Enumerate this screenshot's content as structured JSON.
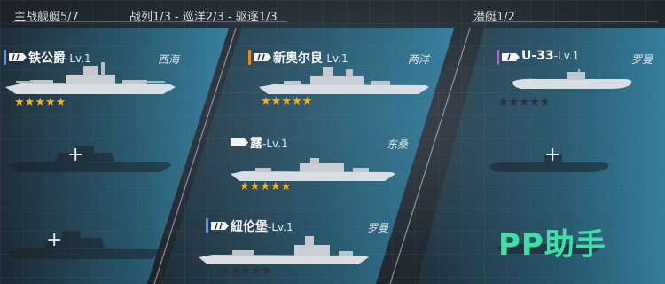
{
  "header": {
    "main_fleet": "主战舰艇5/7",
    "composition": "战列1/3 - 巡洋2/3 - 驱逐1/3",
    "submarine": "潜艇1/2"
  },
  "colors": {
    "panel": "#3a7a96",
    "star_on": "#f2b01e",
    "star_off": "#2b3339",
    "flag_battleship": "#6f94c8",
    "flag_cruiser": "#e08a2a",
    "flag_destroyer": "#6f94c8",
    "flag_submarine": "#9a72c8",
    "watermark": "#3ee0a8"
  },
  "battleships": {
    "slots": [
      {
        "name": "铁公爵",
        "level": "-Lv.1",
        "nation": "西海",
        "stars": 5,
        "max_stars": 5,
        "icon": "battleship-class-icon"
      },
      {
        "empty": true,
        "icon": "plus-icon"
      },
      {
        "empty": true,
        "icon": "plus-icon"
      }
    ]
  },
  "cruisers_destroyers": {
    "slots": [
      {
        "name": "新奥尔良",
        "level": "-Lv.1",
        "nation": "两洋",
        "stars": 5,
        "max_stars": 5,
        "icon": "cruiser-class-icon"
      },
      {
        "name": "露",
        "level": "-Lv.1",
        "nation": "东桑",
        "stars": 5,
        "max_stars": 5,
        "icon": "destroyer-class-icon"
      },
      {
        "name": "紐伦堡",
        "level": "-Lv.1",
        "nation": "罗曼",
        "stars": 0,
        "max_stars": 5,
        "icon": "cruiser-class-icon"
      }
    ]
  },
  "submarines": {
    "slots": [
      {
        "name": "U-33",
        "level": "-Lv.1",
        "nation": "罗曼",
        "stars": 0,
        "max_stars": 5,
        "icon": "submarine-class-icon"
      },
      {
        "empty": true,
        "icon": "plus-icon"
      }
    ]
  },
  "watermark": "PP助手"
}
